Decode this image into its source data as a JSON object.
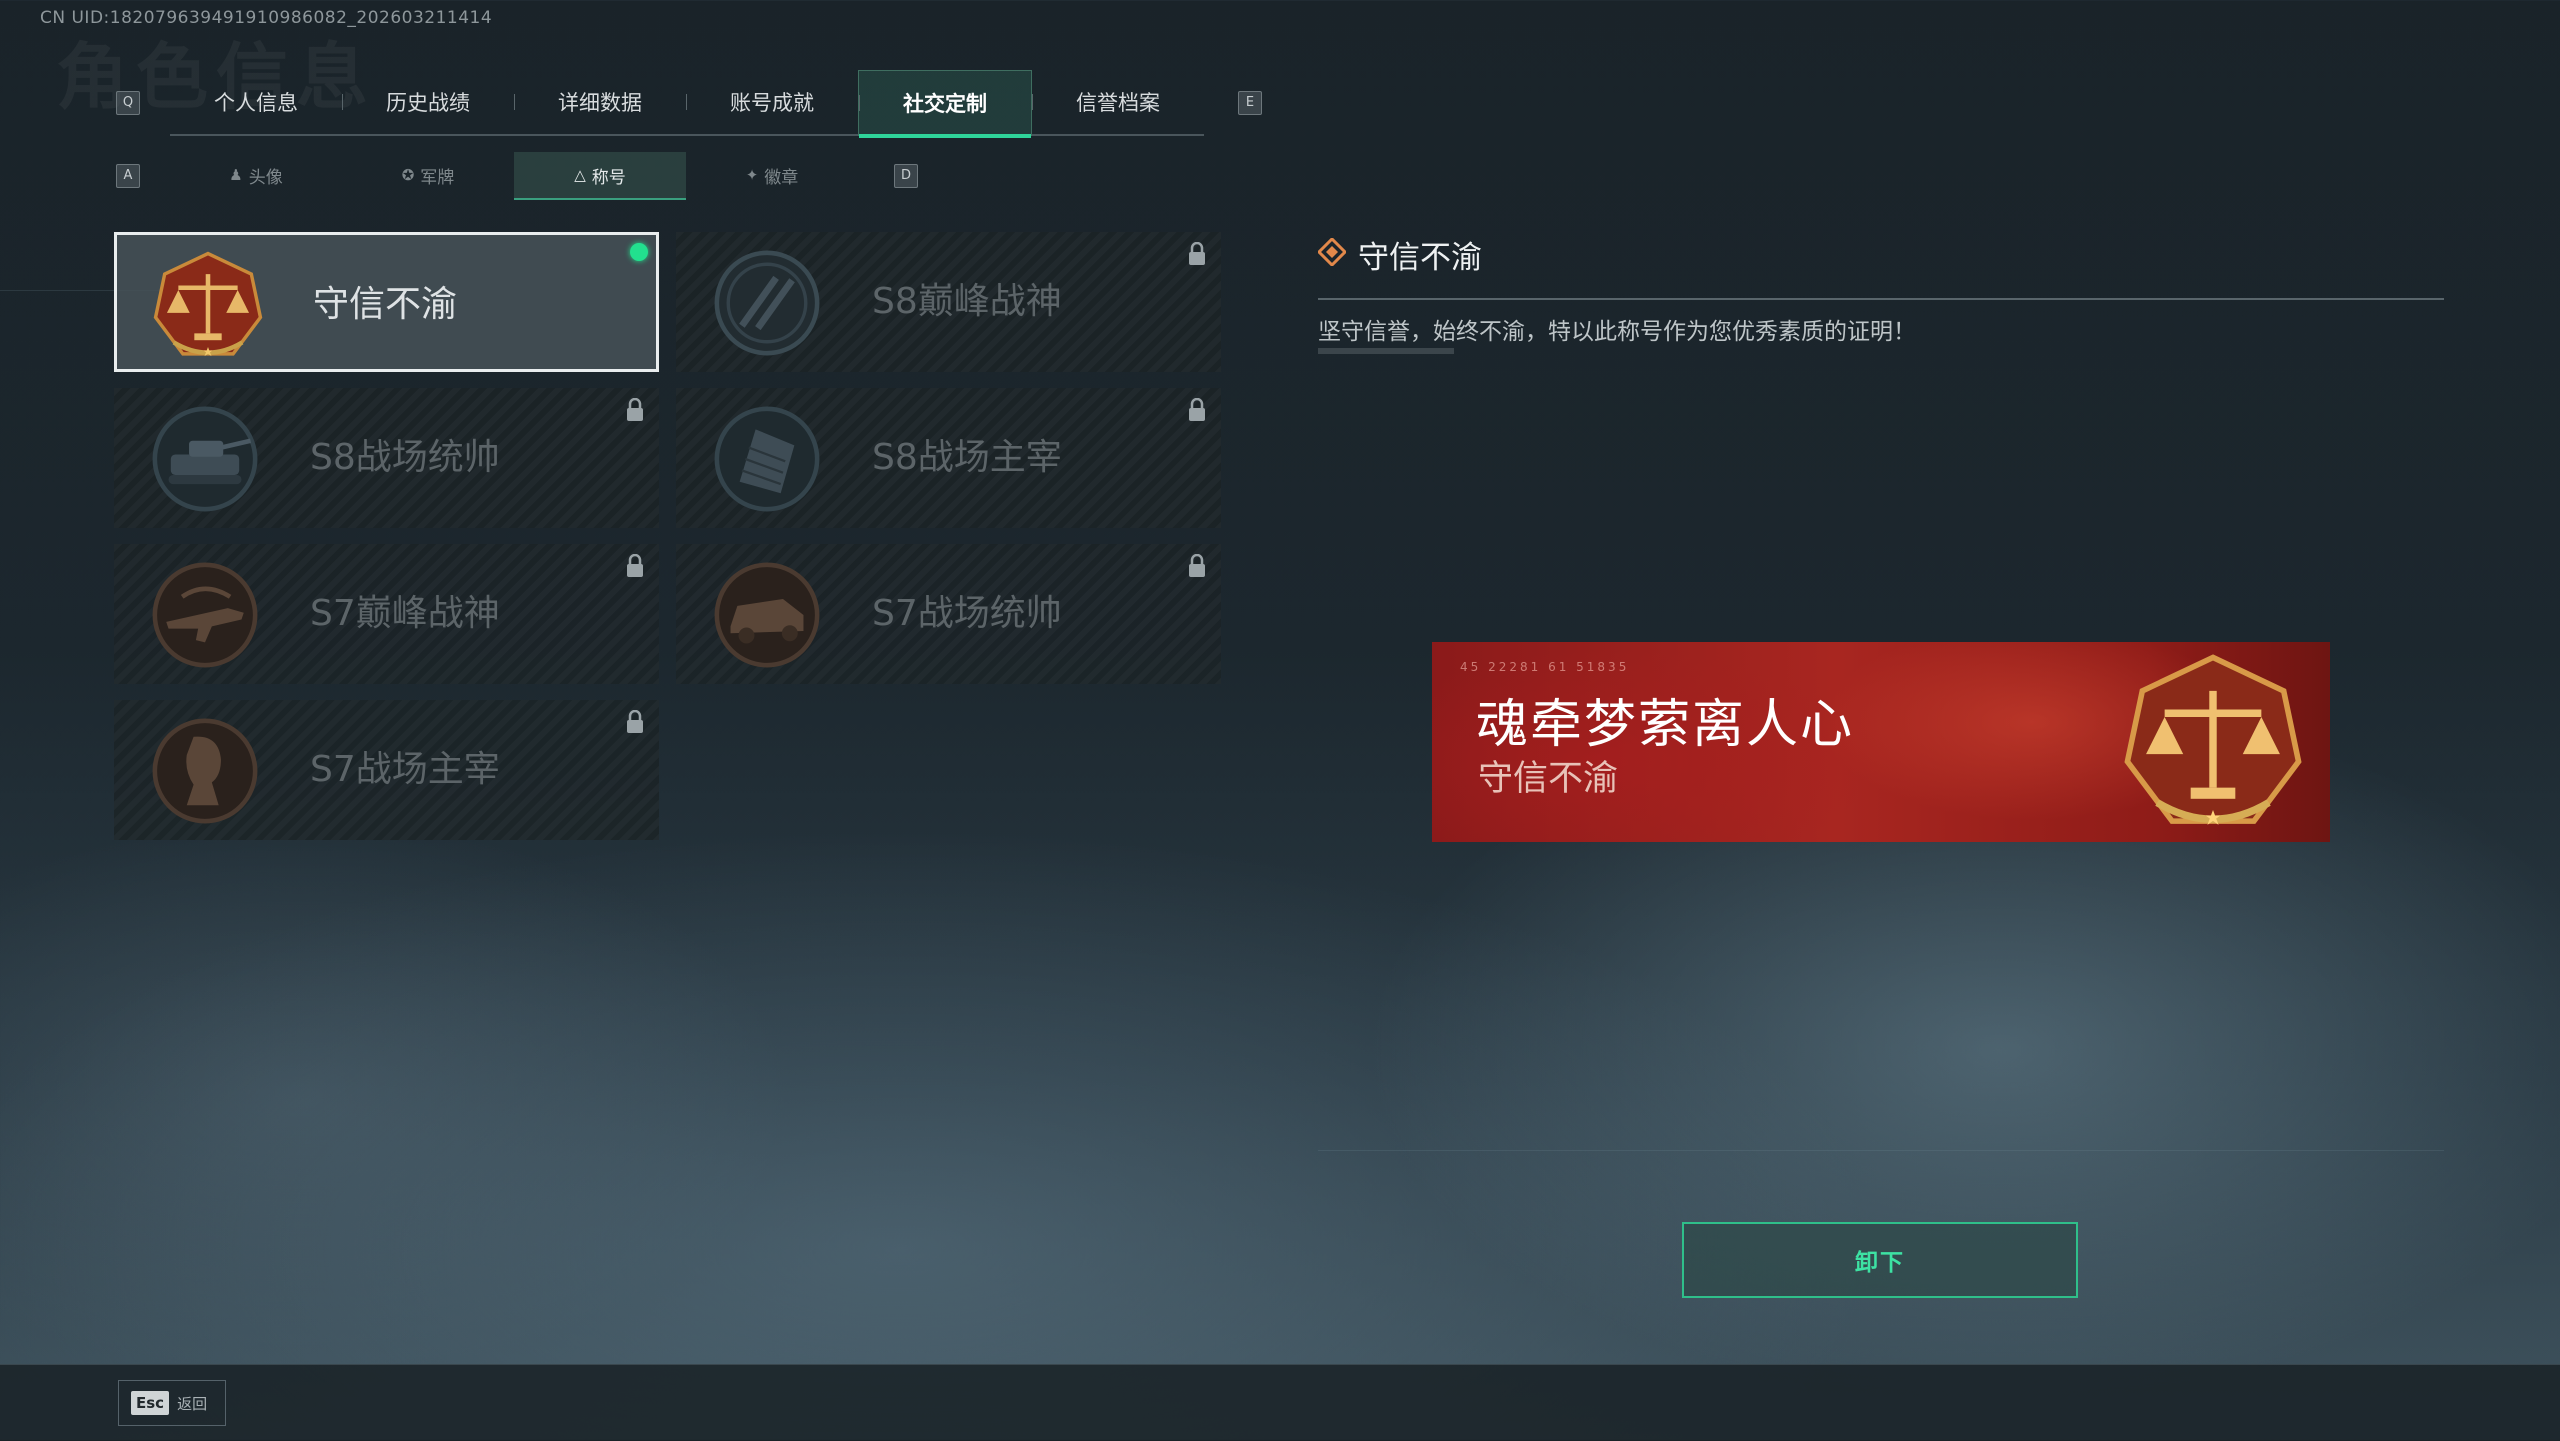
{
  "uid_text": "CN UID:182079639491910986082_202603211414",
  "ghost_title": "角色信息",
  "keys": {
    "prev_main": "Q",
    "next_main": "E",
    "prev_sub": "A",
    "next_sub": "D"
  },
  "main_tabs": [
    {
      "label": "个人信息"
    },
    {
      "label": "历史战绩"
    },
    {
      "label": "详细数据"
    },
    {
      "label": "账号成就"
    },
    {
      "label": "社交定制",
      "active": true
    },
    {
      "label": "信誉档案"
    }
  ],
  "sub_tabs": [
    {
      "label": "头像",
      "icon": "person-icon"
    },
    {
      "label": "军牌",
      "icon": "dogtag-icon"
    },
    {
      "label": "称号",
      "icon": "title-icon",
      "active": true
    },
    {
      "label": "徽章",
      "icon": "badge-icon"
    }
  ],
  "titles": [
    {
      "name": "守信不渝",
      "selected": true,
      "equipped": true,
      "locked": false,
      "emblem": "scales-emblem"
    },
    {
      "name": "S8巅峰战神",
      "locked": true,
      "emblem": "stripes-emblem"
    },
    {
      "name": "S8战场统帅",
      "locked": true,
      "emblem": "tank-emblem"
    },
    {
      "name": "S8战场主宰",
      "locked": true,
      "emblem": "building-emblem"
    },
    {
      "name": "S7巅峰战神",
      "locked": true,
      "emblem": "rifle-emblem"
    },
    {
      "name": "S7战场统帅",
      "locked": true,
      "emblem": "vehicle-emblem"
    },
    {
      "name": "S7战场主宰",
      "locked": true,
      "emblem": "soldier-emblem"
    }
  ],
  "detail": {
    "title": "守信不渝",
    "description": "坚守信誉，始终不渝，特以此称号作为您优秀素质的证明！"
  },
  "banner": {
    "player_name": "魂牵梦萦离人心",
    "title": "守信不渝",
    "code": "45 22281 61 51835"
  },
  "actions": {
    "unequip_label": "卸下",
    "back_key": "Esc",
    "back_label": "返回"
  },
  "colors": {
    "accent": "#2fd59a",
    "banner_red": "#a82620",
    "equipped": "#22e08e"
  }
}
